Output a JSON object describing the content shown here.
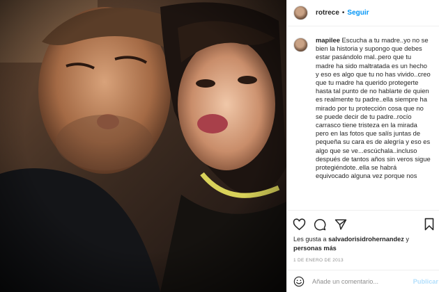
{
  "post": {
    "username": "rotrece",
    "separator": "•",
    "follow_label": "Seguir"
  },
  "comment": {
    "username": "mapilee",
    "text": "Escucha a tu madre..yo no se bien la historia y supongo que debes estar pasándolo mal..pero que tu madre ha sido maltratada es un hecho y eso es algo que tu no has vivido..creo que tu madre ha querido protegerte hasta tal punto de no hablarte de quien es realmente tu padre..ella siempre ha mirado por tu protección cosa que no se puede decir de tu padre..rocío carrasco tiene tristeza en la mirada pero en las fotos que salís juntas de pequeña su cara es de alegría y eso es algo que se ve...escúchala..incluso después de tantos años sin veros sigue protegiéndote..ella se habrá equivocado alguna vez porque nos"
  },
  "likes": {
    "prefix": "Les gusta a",
    "user": "salvadorisidrohernandez",
    "connector": "y",
    "others": "personas más"
  },
  "date": "1 DE ENERO DE 2013",
  "add_comment": {
    "placeholder": "Añade un comentario...",
    "publish_label": "Publicar"
  },
  "icons": {
    "like": "heart-icon",
    "comment": "comment-icon",
    "share": "share-icon",
    "save": "bookmark-icon",
    "emoji": "emoji-icon"
  },
  "colors": {
    "accent": "#0095f6",
    "publish_disabled": "#b2dffc",
    "text": "#262626",
    "muted": "#8e8e8e",
    "border": "#efefef"
  }
}
